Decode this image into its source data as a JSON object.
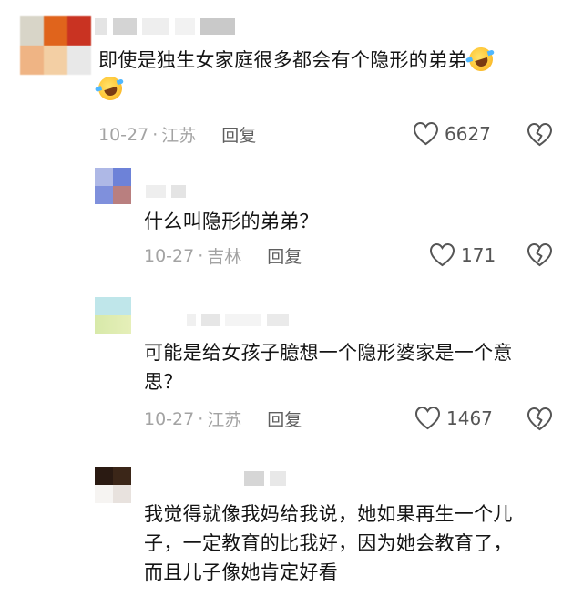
{
  "comments": [
    {
      "text": "即使是独生女家庭很多都会有个隐形的弟弟",
      "emoji": "laughing-crying-emoji",
      "date": "10-27",
      "sep": "·",
      "location": "江苏",
      "reply_label": "回复",
      "likes": "6627"
    },
    {
      "text": "什么叫隐形的弟弟？",
      "date": "10-27",
      "sep": "·",
      "location": "吉林",
      "reply_label": "回复",
      "likes": "171"
    },
    {
      "text_line1": "可能是给女孩子臆想一个隐形婆家是一个意",
      "text_line2": "思？",
      "date": "10-27",
      "sep": "·",
      "location": "江苏",
      "reply_label": "回复",
      "likes": "1467"
    },
    {
      "text_line1": "我觉得就像我妈给我说，她如果再生一个儿",
      "text_line2": "子，一定教育的比我好，因为她会教育了，",
      "text_line3": "而且儿子像她肯定好看"
    }
  ],
  "icons": {
    "like": "heart-outline-icon",
    "dislike": "broken-heart-icon"
  },
  "colors": {
    "text": "#141414",
    "meta": "#a3a3a3",
    "icon": "#555555"
  }
}
